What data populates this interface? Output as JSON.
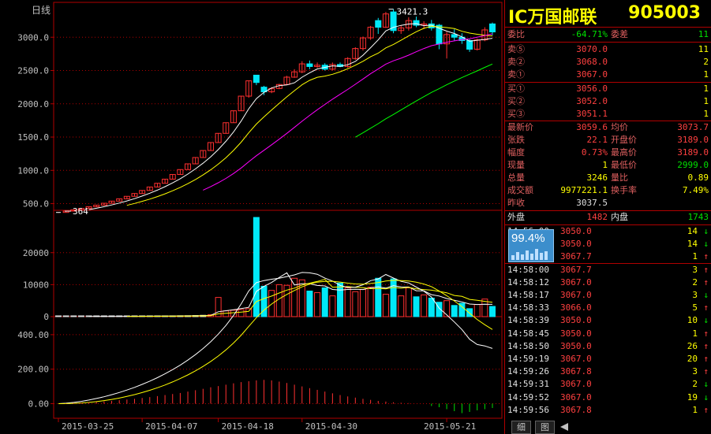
{
  "chart": {
    "period_label": "日线",
    "price_axis": [
      "3000.0",
      "2500.0",
      "2000.0",
      "1500.0",
      "1000.0",
      "500.0"
    ],
    "volume_axis": [
      "20000",
      "10000",
      "0"
    ],
    "indicator_axis": [
      "400.00",
      "200.00",
      "0.00"
    ],
    "dates": [
      "2015-03-25",
      "2015-04-07",
      "2015-04-18",
      "2015-04-30",
      "2015-05-21"
    ],
    "high_annotation": "3421.3",
    "low_annotation": "364"
  },
  "chart_data": {
    "type": "candlestick",
    "price_ylim": [
      400,
      3500
    ],
    "candles": [
      [
        364,
        370,
        360,
        368
      ],
      [
        368,
        390,
        366,
        388
      ],
      [
        388,
        410,
        386,
        408
      ],
      [
        408,
        430,
        406,
        428
      ],
      [
        428,
        455,
        426,
        453
      ],
      [
        453,
        480,
        451,
        478
      ],
      [
        478,
        508,
        476,
        506
      ],
      [
        506,
        540,
        504,
        538
      ],
      [
        538,
        575,
        536,
        572
      ],
      [
        572,
        612,
        570,
        610
      ],
      [
        610,
        655,
        608,
        652
      ],
      [
        652,
        700,
        650,
        698
      ],
      [
        698,
        752,
        696,
        750
      ],
      [
        750,
        808,
        748,
        806
      ],
      [
        806,
        870,
        804,
        868
      ],
      [
        868,
        940,
        866,
        938
      ],
      [
        938,
        1015,
        936,
        1012
      ],
      [
        1012,
        1100,
        1010,
        1098
      ],
      [
        1098,
        1195,
        1096,
        1193
      ],
      [
        1193,
        1300,
        1190,
        1298
      ],
      [
        1298,
        1420,
        1296,
        1418
      ],
      [
        1418,
        1560,
        1416,
        1556
      ],
      [
        1556,
        1720,
        1554,
        1716
      ],
      [
        1716,
        1900,
        1714,
        1895
      ],
      [
        1895,
        2120,
        1893,
        2115
      ],
      [
        2115,
        2350,
        2090,
        2345
      ],
      [
        2430,
        2430,
        2280,
        2320
      ],
      [
        2250,
        2270,
        2130,
        2180
      ],
      [
        2180,
        2250,
        2160,
        2230
      ],
      [
        2230,
        2300,
        2220,
        2290
      ],
      [
        2290,
        2420,
        2280,
        2400
      ],
      [
        2400,
        2520,
        2390,
        2480
      ],
      [
        2480,
        2640,
        2460,
        2600
      ],
      [
        2600,
        2650,
        2520,
        2560
      ],
      [
        2560,
        2620,
        2540,
        2580
      ],
      [
        2580,
        2610,
        2500,
        2520
      ],
      [
        2520,
        2620,
        2500,
        2590
      ],
      [
        2590,
        2620,
        2550,
        2560
      ],
      [
        2560,
        2700,
        2540,
        2680
      ],
      [
        2680,
        2850,
        2660,
        2830
      ],
      [
        2830,
        3010,
        2800,
        2990
      ],
      [
        2990,
        3170,
        2960,
        3150
      ],
      [
        3250,
        3290,
        3050,
        3150
      ],
      [
        3150,
        3380,
        3140,
        3350
      ],
      [
        3380,
        3421,
        3060,
        3100
      ],
      [
        3100,
        3180,
        3050,
        3140
      ],
      [
        3140,
        3300,
        3100,
        3250
      ],
      [
        3250,
        3310,
        3150,
        3180
      ],
      [
        3180,
        3240,
        3120,
        3200
      ],
      [
        3200,
        3260,
        3100,
        3140
      ],
      [
        3180,
        3200,
        2820,
        2900
      ],
      [
        2900,
        3080,
        2680,
        3040
      ],
      [
        3040,
        3120,
        2950,
        3000
      ],
      [
        3000,
        3060,
        2900,
        2950
      ],
      [
        2950,
        2970,
        2780,
        2820
      ],
      [
        2820,
        2980,
        2800,
        2960
      ],
      [
        2960,
        3150,
        2940,
        3110
      ],
      [
        3200,
        3220,
        3030,
        3080
      ]
    ],
    "volume_ylim": [
      0,
      32000
    ],
    "volumes": [
      20,
      30,
      40,
      50,
      60,
      70,
      80,
      90,
      100,
      120,
      140,
      160,
      180,
      200,
      220,
      250,
      280,
      300,
      350,
      420,
      600,
      6000,
      1800,
      2000,
      2200,
      2500,
      31000,
      9500,
      8200,
      10000,
      9800,
      12000,
      11500,
      8000,
      7500,
      9000,
      6500,
      10500,
      9000,
      7800,
      8500,
      9200,
      12000,
      7000,
      11800,
      6500,
      9000,
      6200,
      6800,
      5800,
      4500,
      5000,
      3500,
      4200,
      2500,
      3800,
      5500,
      3200
    ],
    "indicator_ylim": [
      -80,
      500
    ],
    "bars_up": [
      2,
      4,
      6,
      8,
      10,
      13,
      16,
      20,
      24,
      28,
      33,
      38,
      44,
      50,
      56,
      62,
      70,
      78,
      86,
      95,
      102,
      110,
      118,
      125,
      130,
      135,
      138,
      135,
      128,
      120,
      110,
      100,
      90,
      80,
      70,
      60,
      50,
      42,
      35,
      28,
      22,
      16,
      12,
      8,
      5,
      3
    ],
    "bars_down": [
      12,
      18,
      28,
      38,
      48,
      42,
      34,
      28,
      22
    ],
    "ma_labels": []
  },
  "panel": {
    "name": "IC万国邮联",
    "code": "905003",
    "commission_ratio_label": "委比",
    "commission_ratio": "-64.71%",
    "commission_diff_label": "委差",
    "commission_diff": "11",
    "asks": [
      {
        "label": "卖⑤",
        "price": "3070.0",
        "vol": "11"
      },
      {
        "label": "卖②",
        "price": "3068.0",
        "vol": "2"
      },
      {
        "label": "卖①",
        "price": "3067.0",
        "vol": "1"
      }
    ],
    "bids": [
      {
        "label": "买①",
        "price": "3056.0",
        "vol": "1"
      },
      {
        "label": "买②",
        "price": "3052.0",
        "vol": "1"
      },
      {
        "label": "买③",
        "price": "3051.1",
        "vol": "1"
      }
    ],
    "stats": [
      {
        "l1": "最新价",
        "v1": "3059.6",
        "c1": "red",
        "l2": "均价",
        "v2": "3073.7",
        "c2": "red"
      },
      {
        "l1": "张跌",
        "v1": "22.1",
        "c1": "red",
        "l2": "开盘价",
        "v2": "3189.0",
        "c2": "red"
      },
      {
        "l1": "幅度",
        "v1": "0.73%",
        "c1": "red",
        "l2": "最高价",
        "v2": "3189.0",
        "c2": "red"
      },
      {
        "l1": "现量",
        "v1": "1",
        "c1": "yel",
        "l2": "最低价",
        "v2": "2999.0",
        "c2": "green"
      },
      {
        "l1": "总量",
        "v1": "3246",
        "c1": "yel",
        "l2": "量比",
        "v2": "0.89",
        "c2": "yel"
      },
      {
        "l1": "成交额",
        "v1": "9977221.1",
        "c1": "yel",
        "l2": "换手率",
        "v2": "7.49%",
        "c2": "yel"
      },
      {
        "l1": "昨收",
        "v1": "3037.5",
        "c1": "white",
        "l2": "",
        "v2": "",
        "c2": "white"
      }
    ],
    "outer_label": "外盘",
    "outer_value": "1482",
    "inner_label": "内盘",
    "inner_value": "1743",
    "badge": "99.4%",
    "ticks": [
      {
        "t": "14:56:00",
        "p": "3050.0",
        "v": "14",
        "d": "down"
      },
      {
        "t": "14:57:00",
        "p": "3050.0",
        "v": "14",
        "d": "down"
      },
      {
        "t": "14:57:40",
        "p": "3067.7",
        "v": "1",
        "d": "up"
      },
      {
        "t": "14:58:00",
        "p": "3067.7",
        "v": "3",
        "d": "up"
      },
      {
        "t": "14:58:12",
        "p": "3067.0",
        "v": "2",
        "d": "up"
      },
      {
        "t": "14:58:17",
        "p": "3067.0",
        "v": "3",
        "d": "down"
      },
      {
        "t": "14:58:33",
        "p": "3066.0",
        "v": "5",
        "d": "up"
      },
      {
        "t": "14:58:39",
        "p": "3050.0",
        "v": "10",
        "d": "down"
      },
      {
        "t": "14:58:45",
        "p": "3050.0",
        "v": "1",
        "d": "up"
      },
      {
        "t": "14:58:50",
        "p": "3050.0",
        "v": "26",
        "d": "up"
      },
      {
        "t": "14:59:19",
        "p": "3067.0",
        "v": "20",
        "d": "up"
      },
      {
        "t": "14:59:26",
        "p": "3067.8",
        "v": "3",
        "d": "up"
      },
      {
        "t": "14:59:31",
        "p": "3067.0",
        "v": "2",
        "d": "down"
      },
      {
        "t": "14:59:52",
        "p": "3067.0",
        "v": "19",
        "d": "down"
      },
      {
        "t": "14:59:56",
        "p": "3067.8",
        "v": "1",
        "d": "up"
      }
    ],
    "tabs": [
      "细",
      "图"
    ]
  }
}
